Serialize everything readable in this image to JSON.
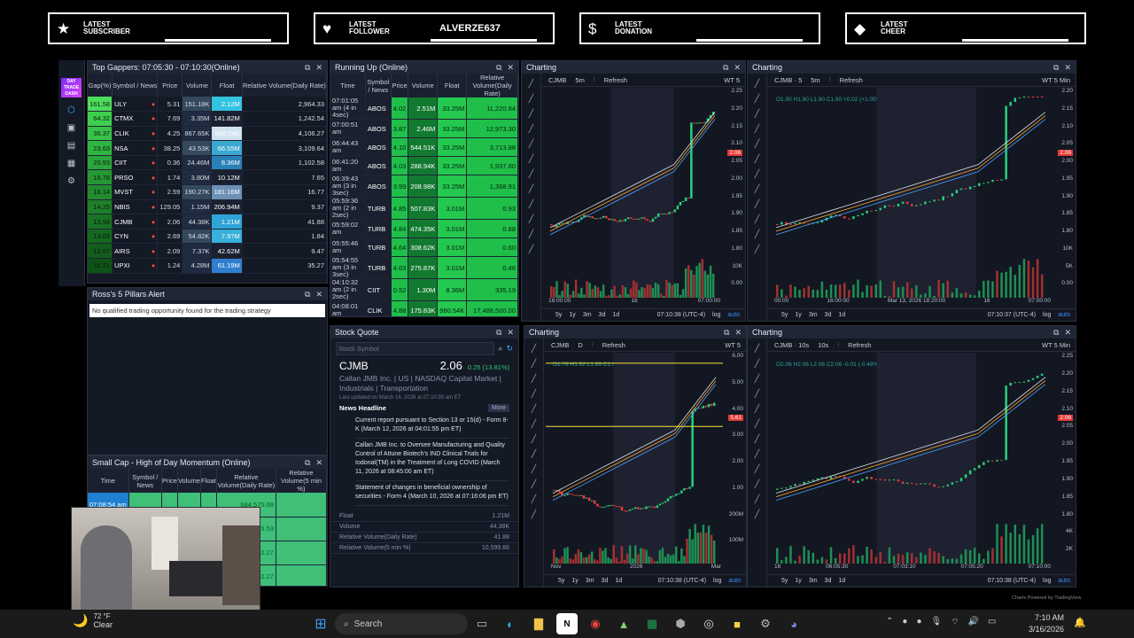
{
  "badges": [
    {
      "icon": "star-icon",
      "glyph": "★",
      "line1": "LATEST",
      "line2": "SUBSCRIBER",
      "name": ""
    },
    {
      "icon": "heart-icon",
      "glyph": "♥",
      "line1": "LATEST",
      "line2": "FOLLOWER",
      "name": "ALVERZE637"
    },
    {
      "icon": "dollar-icon",
      "glyph": "$",
      "line1": "LATEST",
      "line2": "DONATION",
      "name": ""
    },
    {
      "icon": "diamond-icon",
      "glyph": "◆",
      "line1": "LATEST",
      "line2": "CHEER",
      "name": ""
    }
  ],
  "gappers": {
    "title": "Top Gappers: 07:05:30 - 07:10:30(Online)",
    "headers": [
      "Gap(%)",
      "Symbol / News",
      "Price",
      "Volume",
      "Float",
      "Relative Volume(Daily Rate)"
    ],
    "rows": [
      {
        "gap": "161.58",
        "sym": "ULY",
        "price": "5.31",
        "vol": "151.18K",
        "float": "2.12M",
        "rv": "2,964.33"
      },
      {
        "gap": "64.32",
        "sym": "CTMX",
        "price": "7.69",
        "vol": "3.35M",
        "float": "141.82M",
        "rv": "1,242.54"
      },
      {
        "gap": "36.37",
        "sym": "CLIK",
        "price": "4.25",
        "vol": "867.65K",
        "float": "980.54K",
        "rv": "4,106.27"
      },
      {
        "gap": "23.63",
        "sym": "NSA",
        "price": "38.25",
        "vol": "43.53K",
        "float": "66.55M",
        "rv": "3,109.64"
      },
      {
        "gap": "20.93",
        "sym": "CIIT",
        "price": "0.36",
        "vol": "24.46M",
        "float": "8.36M",
        "rv": "1,102.58"
      },
      {
        "gap": "16.78",
        "sym": "PRSO",
        "price": "1.74",
        "vol": "3.80M",
        "float": "10.12M",
        "rv": "7.65"
      },
      {
        "gap": "16.14",
        "sym": "MVST",
        "price": "2.59",
        "vol": "190.27K",
        "float": "181.16M",
        "rv": "16.77"
      },
      {
        "gap": "14.25",
        "sym": "NBIS",
        "price": "129.05",
        "vol": "1.15M",
        "float": "206.94M",
        "rv": "9.37"
      },
      {
        "gap": "13.98",
        "sym": "CJMB",
        "price": "2.06",
        "vol": "44.38K",
        "float": "1.21M",
        "rv": "41.88"
      },
      {
        "gap": "13.03",
        "sym": "CYN",
        "price": "2.69",
        "vol": "54.82K",
        "float": "7.97M",
        "rv": "1.84"
      },
      {
        "gap": "12.97",
        "sym": "AIRS",
        "price": "2.09",
        "vol": "7.37K",
        "float": "42.62M",
        "rv": "9.47"
      },
      {
        "gap": "11.71",
        "sym": "UPXI",
        "price": "1.24",
        "vol": "4.28M",
        "float": "61.19M",
        "rv": "35.27"
      }
    ]
  },
  "running": {
    "title": "Running Up (Online)",
    "headers": [
      "Time",
      "Symbol / News",
      "Price",
      "Volume",
      "Float",
      "Relative Volume(Daily Rate)"
    ],
    "rows": [
      {
        "time": "07:01:05 am (4 in 4sec)",
        "sym": "ABOS",
        "price": "4.02",
        "vol": "2.51M",
        "float": "33.25M",
        "rv": "11,220.84"
      },
      {
        "time": "07:00:51 am",
        "sym": "ABOS",
        "price": "3.87",
        "vol": "2.46M",
        "float": "33.25M",
        "rv": "12,973.30"
      },
      {
        "time": "06:44:43 am",
        "sym": "ABOS",
        "price": "4.10",
        "vol": "544.51K",
        "float": "33.25M",
        "rv": "3,713.88"
      },
      {
        "time": "06:41:20 am",
        "sym": "ABOS",
        "price": "4.03",
        "vol": "288.94K",
        "float": "33.25M",
        "rv": "1,937.80"
      },
      {
        "time": "06:39:43 am (3 in 3sec)",
        "sym": "ABOS",
        "price": "3.99",
        "vol": "208.98K",
        "float": "33.25M",
        "rv": "1,368.91"
      },
      {
        "time": "05:59:36 am (2 in 2sec)",
        "sym": "TURB",
        "price": "4.85",
        "vol": "507.83K",
        "float": "3.01M",
        "rv": "0.93"
      },
      {
        "time": "05:59:02 am",
        "sym": "TURB",
        "price": "4.84",
        "vol": "474.35K",
        "float": "3.01M",
        "rv": "0.88"
      },
      {
        "time": "05:55:46 am",
        "sym": "TURB",
        "price": "4.64",
        "vol": "308.62K",
        "float": "3.01M",
        "rv": "0.60"
      },
      {
        "time": "05:54:55 am (3 in 3sec)",
        "sym": "TURB",
        "price": "4.63",
        "vol": "275.87K",
        "float": "3.01M",
        "rv": "0.46"
      },
      {
        "time": "04:10:32 am (2 in 2sec)",
        "sym": "CIIT",
        "price": "0.52",
        "vol": "1.30M",
        "float": "8.36M",
        "rv": "335.19"
      },
      {
        "time": "04:08:01 am",
        "sym": "CLIK",
        "price": "4.88",
        "vol": "175.83K",
        "float": "980.54K",
        "rv": "17,488,500.00"
      }
    ]
  },
  "pillars": {
    "title": "Ross's 5 Pillars Alert",
    "message": "No qualified trading opportunity found for the trading strategy"
  },
  "smallcap": {
    "title": "Small Cap - High of Day Momentum (Online)",
    "headers": [
      "Time",
      "Symbol / News",
      "Price",
      "Volume",
      "Float",
      "Relative Volume(Daily Rate)",
      "Relative Volume(5 min %)"
    ],
    "rows": [
      {
        "time": "07:08:54 am",
        "rv": "684,575.68"
      },
      {
        "time": "",
        "rv": "808,665.53"
      },
      {
        "time": "",
        "rv": "454,252.27"
      },
      {
        "time": "",
        "rv": "390,102.27"
      }
    ]
  },
  "quote": {
    "title": "Stock Quote",
    "placeholder": "Stock Symbol",
    "symbol": "CJMB",
    "price": "2.06",
    "change": "0.25 (13.81%)",
    "company": "Callan JMB Inc. | US | NASDAQ Capital Market | Industrials | Transportation",
    "updated": "Last updated on March 16, 2026 at 07:10:30 am ET",
    "news_title": "News Headline",
    "more": "More",
    "news": [
      "Current report pursuant to Section 13 or 15(d) - Form 8-K (March 12, 2026 at 04:01:55 pm ET)",
      "Callan JMB Inc. to Oversee Manufacturing and Quality Control of Attune Biotech's IND Clinical Trials for Iodonal(TM) in the Treatment of Long COVID (March 11, 2026 at 08:45:00 am ET)",
      "Statement of changes in beneficial ownership of securities - Form 4 (March 10, 2026 at 07:16:06 pm ET)"
    ],
    "stats": [
      {
        "k": "Float",
        "v": "1.21M"
      },
      {
        "k": "Volume",
        "v": "44.38K"
      },
      {
        "k": "Relative Volume(Daily Rate)",
        "v": "41.88"
      },
      {
        "k": "Relative Volume(5 min %)",
        "v": "10,599.86"
      }
    ]
  },
  "charts": [
    {
      "title": "Charting",
      "tf": "5m",
      "sym": "CJMB",
      "ohlc": "",
      "study": "WT 5",
      "time": "07:10:38 (UTC-4)",
      "xticks": [
        "18:00:00",
        "16",
        "07:00:00"
      ],
      "yticks": [
        "2.25",
        "2.20",
        "2.15",
        "2.10",
        "2.05",
        "2.00",
        "1.95",
        "1.90",
        "1.85",
        "1.80",
        "10K",
        "0.00"
      ],
      "tag": "2.06"
    },
    {
      "title": "Charting",
      "tf": "5m",
      "sym": "CJMB · 5",
      "ohlc": "O1.90 H1.90 L1.90 C1.90 +0.02 (+1.05%)",
      "study": "WT 5 Min",
      "time": "07:10:37 (UTC-4)",
      "xticks": [
        "00:00",
        "16:00:00",
        "Mar 13, 2026 18:20:00",
        "16",
        "07:00:00"
      ],
      "yticks": [
        "2.20",
        "2.15",
        "2.10",
        "2.05",
        "2.00",
        "1.95",
        "1.90",
        "1.85",
        "1.80",
        "10K",
        "5K",
        "0.00"
      ],
      "tag": "2.06"
    },
    {
      "title": "Charting",
      "tf": "D",
      "sym": "CJMB",
      "ohlc": "O1.78 H1.92 L1.69 C1.81 +0.04 (+2.26%)",
      "study": "WT 5",
      "time": "07:10:38 (UTC-4)",
      "xticks": [
        "Nov",
        "2026",
        "Mar"
      ],
      "yticks": [
        "6.00",
        "5.00",
        "4.00",
        "3.00",
        "2.00",
        "1.00",
        "200M",
        "100M"
      ],
      "tag": "5.61"
    },
    {
      "title": "Charting",
      "tf": "10s",
      "sym": "CJMB · 10s",
      "ohlc": "O2.06 H2.06 L2.06 C2.06 -0.01 (-0.48%)",
      "study": "WT 5 Min",
      "time": "07:10:38 (UTC-4)",
      "xticks": [
        "16",
        "06:05:30",
        "07:03:10",
        "07:05:20",
        "07:10:00"
      ],
      "yticks": [
        "2.25",
        "2.20",
        "2.15",
        "2.10",
        "2.05",
        "2.00",
        "1.95",
        "1.90",
        "1.85",
        "1.80",
        "4K",
        "2K"
      ],
      "tag": "2.06"
    }
  ],
  "chart_labels": {
    "refresh": "Refresh",
    "footer": [
      "5y",
      "1y",
      "3m",
      "3d",
      "1d"
    ],
    "log": "log",
    "auto": "auto",
    "powered": "Charts Powered by TradingView"
  },
  "taskbar": {
    "weather_temp": "72 °F",
    "weather_text": "Clear",
    "search": "Search",
    "time": "7:10 AM",
    "date": "3/16/2026"
  },
  "sidebar": {
    "logo": "DAY TRADE DASH"
  }
}
